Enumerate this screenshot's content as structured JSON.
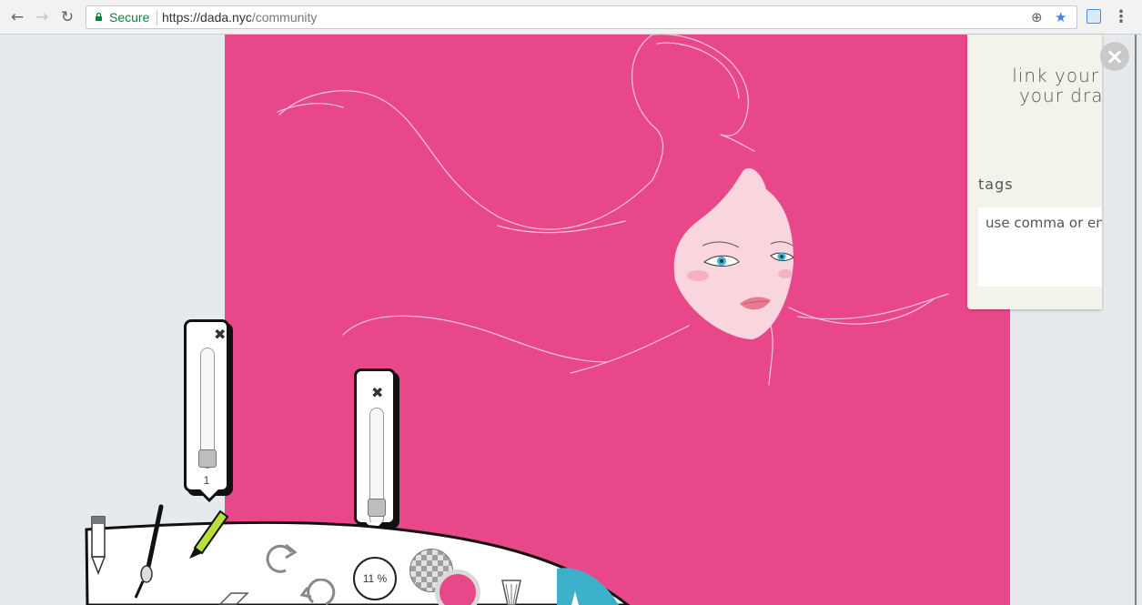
{
  "browser": {
    "secure_label": "Secure",
    "url_host": "https://dada.nyc",
    "url_path": "/community",
    "back_icon": "arrow-left-icon",
    "forward_icon": "arrow-right-icon",
    "reload_icon": "reload-icon",
    "zoom_icon": "zoom-icon",
    "bookmark_icon": "star-icon"
  },
  "canvas": {
    "background": "#e8488a"
  },
  "side_panel": {
    "fb_line1": "link your fb a",
    "fb_line2": "your drawin",
    "tags_label": "tags",
    "tags_placeholder": "use comma or ent"
  },
  "brush_size_popup": {
    "close": "✖",
    "value": "1"
  },
  "opacity_popup": {
    "close": "✖"
  },
  "toolbar": {
    "opacity_percent": "11 %",
    "current_color": "#e8488a",
    "accent_color": "#3cb0c9"
  }
}
